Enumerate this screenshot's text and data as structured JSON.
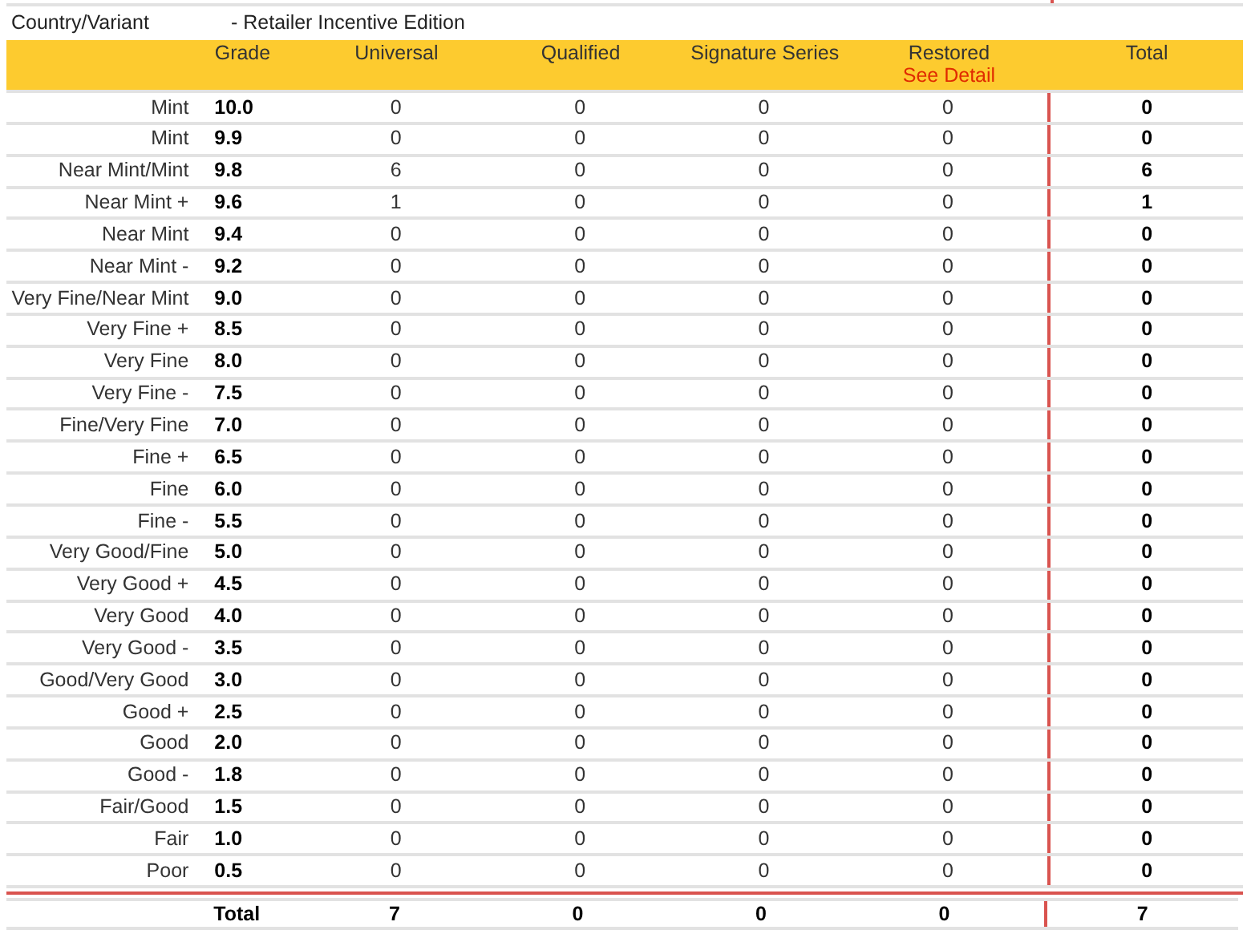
{
  "variant": {
    "label": "Country/Variant",
    "value": "- Retailer Incentive Edition"
  },
  "columns": [
    {
      "label": "Grade"
    },
    {
      "label": "Universal"
    },
    {
      "label": "Qualified"
    },
    {
      "label": "Signature Series"
    },
    {
      "label": "Restored",
      "link": "See Detail"
    },
    {
      "label": "Total"
    }
  ],
  "rows": [
    {
      "name": "Mint",
      "grade": "10.0",
      "counts": [
        "0",
        "0",
        "0",
        "0"
      ],
      "total": "0"
    },
    {
      "name": "Mint",
      "grade": "9.9",
      "counts": [
        "0",
        "0",
        "0",
        "0"
      ],
      "total": "0"
    },
    {
      "name": "Near Mint/Mint",
      "grade": "9.8",
      "counts": [
        "6",
        "0",
        "0",
        "0"
      ],
      "total": "6"
    },
    {
      "name": "Near Mint +",
      "grade": "9.6",
      "counts": [
        "1",
        "0",
        "0",
        "0"
      ],
      "total": "1"
    },
    {
      "name": "Near Mint",
      "grade": "9.4",
      "counts": [
        "0",
        "0",
        "0",
        "0"
      ],
      "total": "0"
    },
    {
      "name": "Near Mint -",
      "grade": "9.2",
      "counts": [
        "0",
        "0",
        "0",
        "0"
      ],
      "total": "0"
    },
    {
      "name": "Very Fine/Near Mint",
      "grade": "9.0",
      "counts": [
        "0",
        "0",
        "0",
        "0"
      ],
      "total": "0"
    },
    {
      "name": "Very Fine +",
      "grade": "8.5",
      "counts": [
        "0",
        "0",
        "0",
        "0"
      ],
      "total": "0"
    },
    {
      "name": "Very Fine",
      "grade": "8.0",
      "counts": [
        "0",
        "0",
        "0",
        "0"
      ],
      "total": "0"
    },
    {
      "name": "Very Fine -",
      "grade": "7.5",
      "counts": [
        "0",
        "0",
        "0",
        "0"
      ],
      "total": "0"
    },
    {
      "name": "Fine/Very Fine",
      "grade": "7.0",
      "counts": [
        "0",
        "0",
        "0",
        "0"
      ],
      "total": "0"
    },
    {
      "name": "Fine +",
      "grade": "6.5",
      "counts": [
        "0",
        "0",
        "0",
        "0"
      ],
      "total": "0"
    },
    {
      "name": "Fine",
      "grade": "6.0",
      "counts": [
        "0",
        "0",
        "0",
        "0"
      ],
      "total": "0"
    },
    {
      "name": "Fine -",
      "grade": "5.5",
      "counts": [
        "0",
        "0",
        "0",
        "0"
      ],
      "total": "0"
    },
    {
      "name": "Very Good/Fine",
      "grade": "5.0",
      "counts": [
        "0",
        "0",
        "0",
        "0"
      ],
      "total": "0"
    },
    {
      "name": "Very Good +",
      "grade": "4.5",
      "counts": [
        "0",
        "0",
        "0",
        "0"
      ],
      "total": "0"
    },
    {
      "name": "Very Good",
      "grade": "4.0",
      "counts": [
        "0",
        "0",
        "0",
        "0"
      ],
      "total": "0"
    },
    {
      "name": "Very Good -",
      "grade": "3.5",
      "counts": [
        "0",
        "0",
        "0",
        "0"
      ],
      "total": "0"
    },
    {
      "name": "Good/Very Good",
      "grade": "3.0",
      "counts": [
        "0",
        "0",
        "0",
        "0"
      ],
      "total": "0"
    },
    {
      "name": "Good +",
      "grade": "2.5",
      "counts": [
        "0",
        "0",
        "0",
        "0"
      ],
      "total": "0"
    },
    {
      "name": "Good",
      "grade": "2.0",
      "counts": [
        "0",
        "0",
        "0",
        "0"
      ],
      "total": "0"
    },
    {
      "name": "Good -",
      "grade": "1.8",
      "counts": [
        "0",
        "0",
        "0",
        "0"
      ],
      "total": "0"
    },
    {
      "name": "Fair/Good",
      "grade": "1.5",
      "counts": [
        "0",
        "0",
        "0",
        "0"
      ],
      "total": "0"
    },
    {
      "name": "Fair",
      "grade": "1.0",
      "counts": [
        "0",
        "0",
        "0",
        "0"
      ],
      "total": "0"
    },
    {
      "name": "Poor",
      "grade": "0.5",
      "counts": [
        "0",
        "0",
        "0",
        "0"
      ],
      "total": "0"
    }
  ],
  "totals": {
    "label": "Total",
    "counts": [
      "7",
      "0",
      "0",
      "0"
    ],
    "total": "7"
  }
}
